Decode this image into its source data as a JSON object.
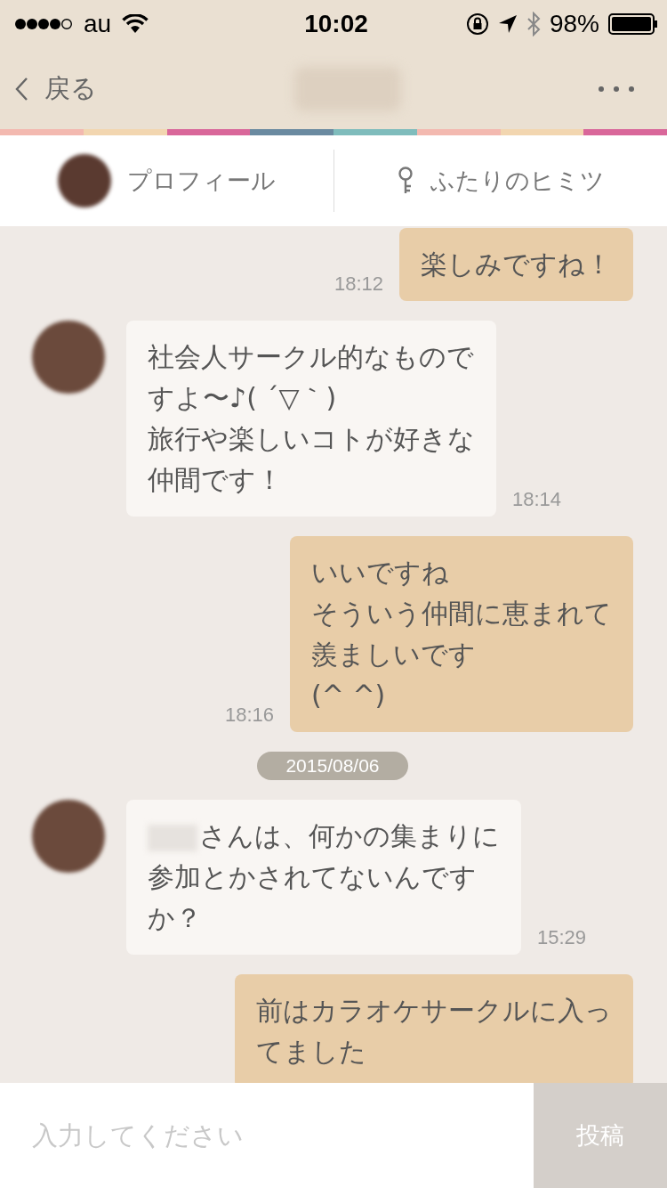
{
  "status_bar": {
    "carrier": "au",
    "time": "10:02",
    "battery": "98%"
  },
  "nav": {
    "back": "戻る"
  },
  "tabs": [
    {
      "label": "プロフィール",
      "kind": "avatar"
    },
    {
      "label": "ふたりのヒミツ",
      "kind": "key"
    }
  ],
  "messages": [
    {
      "kind": "sent",
      "lines": [
        "楽しみですね！"
      ],
      "time": "18:12"
    },
    {
      "kind": "received",
      "name_hidden": false,
      "lines": [
        "社会人サークル的なもので",
        "すよ〜♪( ´▽｀)",
        "旅行や楽しいコトが好きな",
        "仲間です！"
      ],
      "time": "18:14"
    },
    {
      "kind": "sent",
      "lines": [
        "いいですね",
        "そういう仲間に恵まれて",
        "羨ましいです",
        "(^ ^)"
      ],
      "time": "18:16"
    },
    {
      "kind": "date",
      "text": "2015/08/06"
    },
    {
      "kind": "received",
      "name_hidden": true,
      "lines": [
        "さんは、何かの集まりに",
        "参加とかされてないんです",
        "か？"
      ],
      "time": "15:29"
    },
    {
      "kind": "sent",
      "lines": [
        "前はカラオケサークルに入っ",
        "てました"
      ]
    }
  ],
  "composer": {
    "placeholder": "入力してください",
    "send": "投稿"
  }
}
